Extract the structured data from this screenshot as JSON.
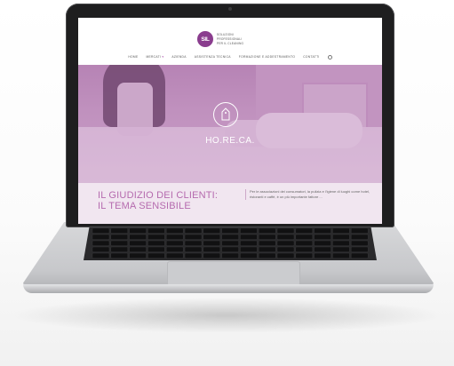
{
  "site": {
    "logo": {
      "mark": "SIL",
      "lines": [
        "SOLUZIONI",
        "PROFESSIONALI",
        "PER IL CLEANING"
      ]
    },
    "nav": {
      "items": [
        {
          "label": "HOME"
        },
        {
          "label": "MERCATI",
          "active": true
        },
        {
          "label": "AZIENDA"
        },
        {
          "label": "ASSISTENZA TECNICA"
        },
        {
          "label": "FORMAZIONE E ADDESTRAMENTO"
        },
        {
          "label": "CONTATTI"
        }
      ]
    }
  },
  "hero": {
    "title": "HO.RE.CA."
  },
  "content": {
    "heading_line1": "IL GIUDIZIO DEI CLIENTI:",
    "heading_line2": "IL TEMA SENSIBILE",
    "body": "Per le associazioni dei consumatori, la pulizia e l'igiene di luoghi come hotel, ristoranti e caffè, è un più importante fattore ..."
  },
  "colors": {
    "brand": "#8a3d8e",
    "accent": "#b56aae",
    "hero_tint": "#c79fc4"
  }
}
